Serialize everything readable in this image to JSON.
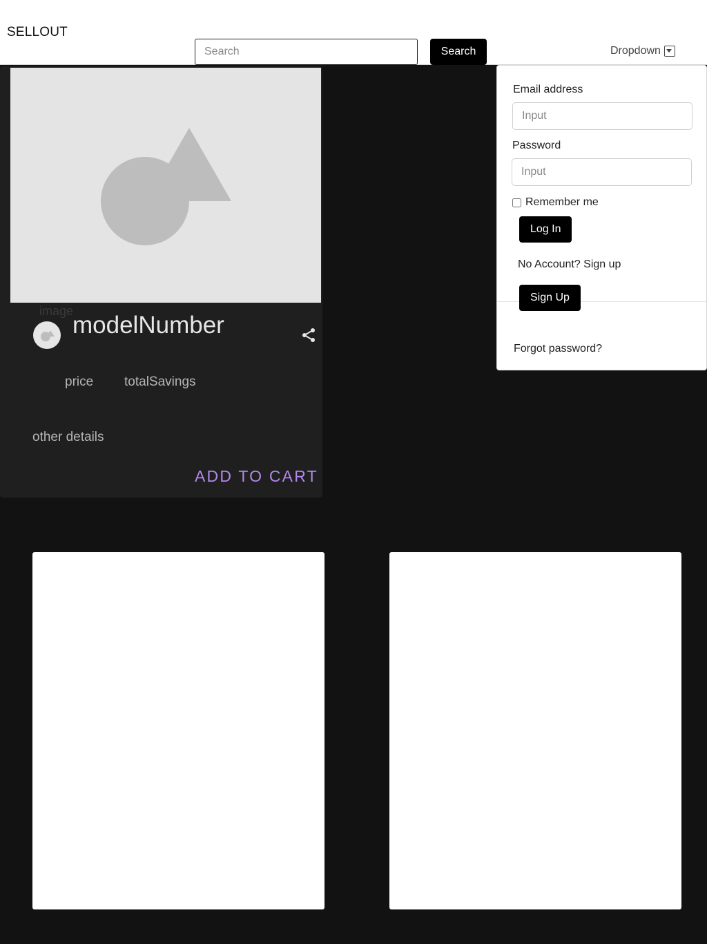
{
  "header": {
    "brand": "SELLOUT",
    "search_placeholder": "Search",
    "search_button": "Search",
    "dropdown_label": "Dropdown"
  },
  "product_card": {
    "image_alt": "image",
    "model_number": "modelNumber",
    "price": "price",
    "total_savings": "totalSavings",
    "details": "other details",
    "add_to_cart": "ADD TO CART",
    "accent_color": "#b388eb"
  },
  "login_menu": {
    "email_label": "Email address",
    "email_placeholder": "Input",
    "password_label": "Password",
    "password_placeholder": "Input",
    "remember_label": "Remember me",
    "login_button": "Log In",
    "no_account_text": "No Account? Sign up",
    "signup_button": "Sign Up",
    "forgot_link": "Forgot password?"
  },
  "icons": {
    "caret": "chevron-down-icon",
    "share": "share-icon",
    "image_placeholder": "image-placeholder-icon"
  }
}
